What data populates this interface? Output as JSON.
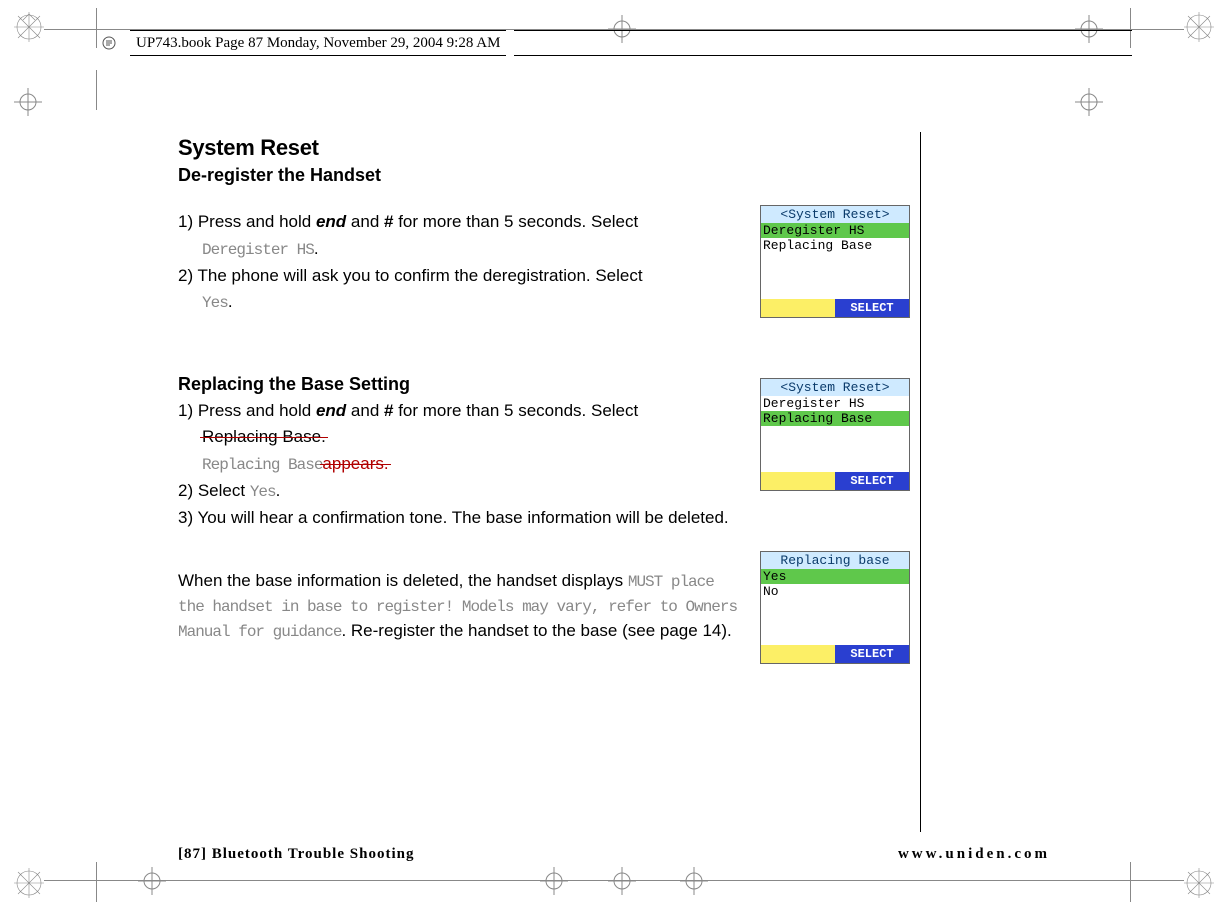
{
  "header": {
    "book_ref": "UP743.book  Page 87  Monday, November 29, 2004  9:28 AM"
  },
  "content": {
    "heading_main": "System Reset",
    "heading_sub": "De-register the Handset",
    "section1": {
      "step1_prefix": "1) Press and hold ",
      "step1_kw1": "end",
      "step1_mid": " and ",
      "step1_kw2": "#",
      "step1_suffix": " for more than 5 seconds. Select",
      "step1_code": "Deregister HS",
      "step1_period": ".",
      "step2_text": "2) The phone will ask you to confirm the deregistration. Select",
      "step2_code": "Yes",
      "step2_period": "."
    },
    "section2_heading": "Replacing the Base Setting",
    "section2": {
      "step1_prefix": "1) Press and hold ",
      "step1_kw1": "end",
      "step1_mid": " and ",
      "step1_kw2": "#",
      "step1_suffix": " for more than 5 seconds. Select",
      "strike1": "Replacing Base.",
      "code1": "Replacing Base",
      "strike2": " appears.",
      "step2_prefix": "2) Select ",
      "step2_code": "Yes",
      "step2_period": ".",
      "step3": "3) You will hear a confirmation tone. The base information will be deleted."
    },
    "para3": {
      "line1": "When the base information is deleted, the handset displays",
      "code1": "MUST place the handset in base to register! Models may vary, refer to Owners Manual for guidance",
      "tail": ". Re-register the handset to the base (see page 14)."
    }
  },
  "screens": {
    "s1": {
      "title": "<System Reset>",
      "line1": "Deregister HS",
      "line2": "Replacing Base",
      "softkey": "SELECT"
    },
    "s2": {
      "title": "<System Reset>",
      "line1": "Deregister HS",
      "line2": "Replacing Base",
      "softkey": "SELECT"
    },
    "s3": {
      "title": "Replacing base",
      "line1": "Yes",
      "line2": "No",
      "softkey": "SELECT"
    }
  },
  "footer": {
    "left": "[87] Bluetooth Trouble Shooting",
    "right": "www.uniden.com"
  }
}
